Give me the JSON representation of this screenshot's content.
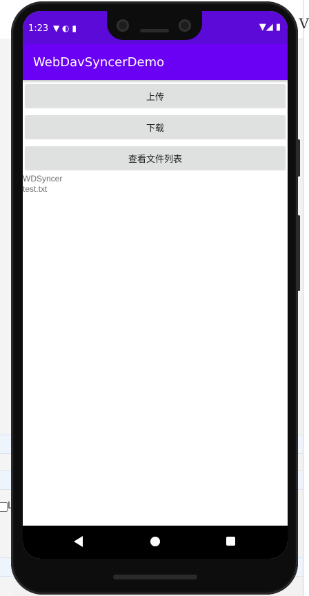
{
  "background": {
    "right_edge_letter": "V",
    "checkbox_label": "L"
  },
  "status_bar": {
    "time": "1:23",
    "left_icons": "▼ ◐ ▮",
    "right_icons": "▼◢ ▮"
  },
  "app": {
    "title": "WebDavSyncerDemo"
  },
  "buttons": {
    "upload": "上传",
    "download": "下载",
    "list_files": "查看文件列表"
  },
  "file_list": [
    "WDSyncer",
    "test.txt"
  ],
  "colors": {
    "status_bar": "#5b0ad8",
    "app_bar": "#6a00f4",
    "button_bg": "#dfe0e0",
    "file_text": "#6d6d6d"
  },
  "icons": [
    "wifi-icon",
    "signal-icon",
    "battery-icon",
    "back-icon",
    "home-icon",
    "recents-icon"
  ]
}
